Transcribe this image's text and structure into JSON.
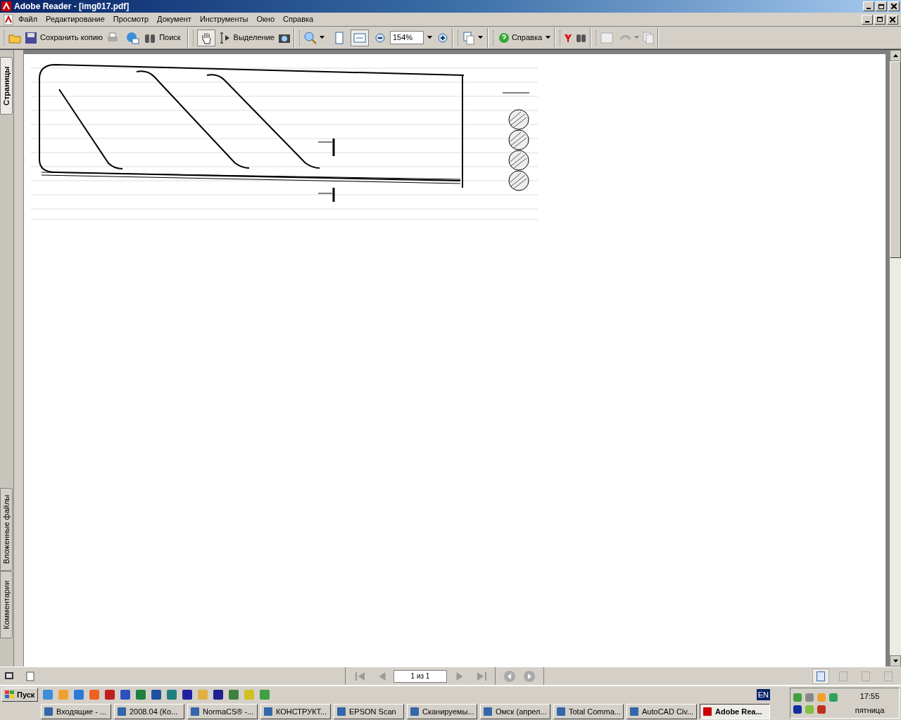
{
  "window": {
    "title": "Adobe Reader - [img017.pdf]"
  },
  "menu": [
    "Файл",
    "Редактирование",
    "Просмотр",
    "Документ",
    "Инструменты",
    "Окно",
    "Справка"
  ],
  "toolbar": {
    "save_label": "Сохранить копию",
    "search_label": "Поиск",
    "hand_selected": true,
    "select_label": "Выделение",
    "fit_width_selected": true,
    "zoom_value": "154%",
    "help_label": "Справка"
  },
  "side_tabs": [
    {
      "label": "Страницы",
      "selected": true
    },
    {
      "label": "Вложенные файлы",
      "selected": false
    },
    {
      "label": "Комментарии",
      "selected": false
    }
  ],
  "status_bar": {
    "page_field": "1 из 1",
    "views": [
      {
        "selected": true
      },
      {
        "selected": false
      },
      {
        "selected": false
      },
      {
        "selected": false
      }
    ]
  },
  "taskbar": {
    "start_label": "Пуск",
    "tasks": [
      {
        "label": "Входящие - ...",
        "selected": false
      },
      {
        "label": "2008.04 (Ко...",
        "selected": false
      },
      {
        "label": "NormaCS® -...",
        "selected": false
      },
      {
        "label": "КОНСТРУКТ...",
        "selected": false
      },
      {
        "label": "EPSON Scan",
        "selected": false
      },
      {
        "label": "Сканируемы...",
        "selected": false
      },
      {
        "label": "Омск (апрел...",
        "selected": false
      },
      {
        "label": "Total Comma...",
        "selected": false
      },
      {
        "label": "AutoCAD Civ...",
        "selected": false
      },
      {
        "label": "Adobe Rea...",
        "selected": true
      }
    ],
    "language": "EN",
    "time": "17:55",
    "day": "пятница"
  }
}
